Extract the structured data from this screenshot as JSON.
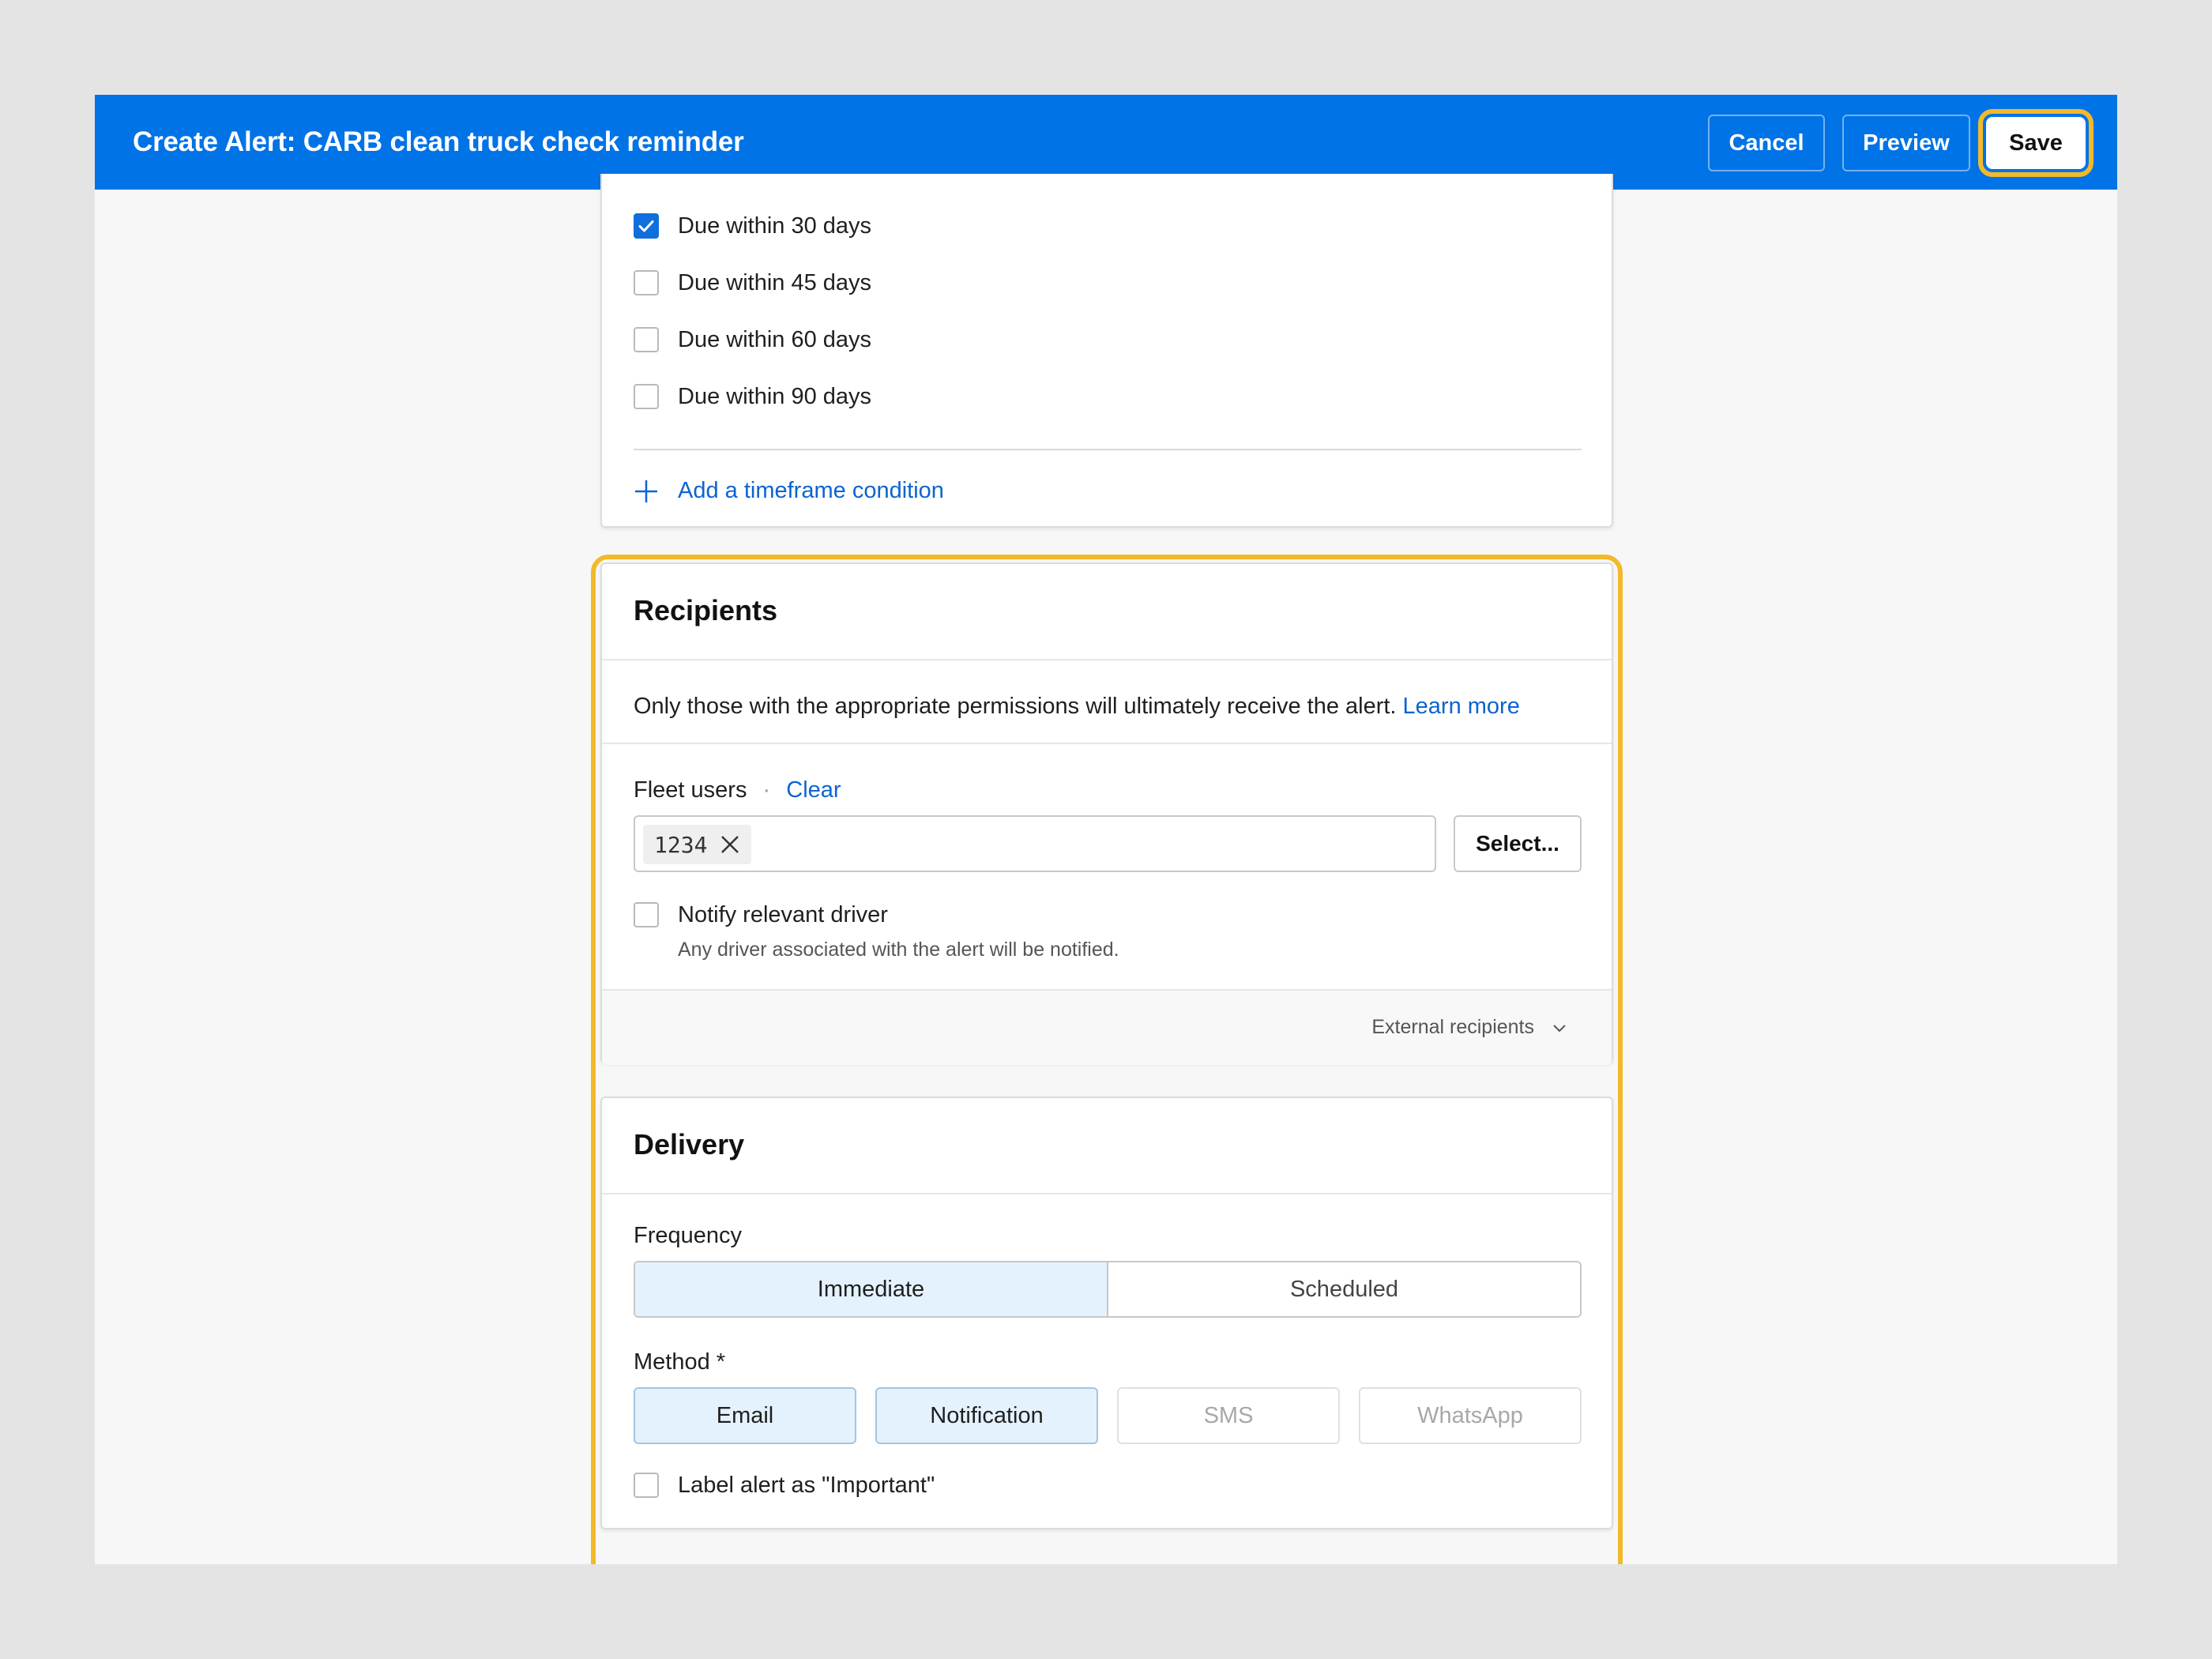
{
  "header": {
    "title": "Create Alert: CARB clean truck check reminder",
    "cancel_label": "Cancel",
    "preview_label": "Preview",
    "save_label": "Save"
  },
  "timeframe": {
    "options": [
      {
        "label": "Due within 30 days",
        "checked": true
      },
      {
        "label": "Due within 45 days",
        "checked": false
      },
      {
        "label": "Due within 60 days",
        "checked": false
      },
      {
        "label": "Due within 90 days",
        "checked": false
      }
    ],
    "add_condition_label": "Add a timeframe condition"
  },
  "recipients": {
    "title": "Recipients",
    "info_text": "Only those with the appropriate permissions will ultimately receive the alert.",
    "learn_more_label": "Learn more",
    "fleet_users_label": "Fleet users",
    "separator": "·",
    "clear_label": "Clear",
    "selected_users": [
      "1234"
    ],
    "select_button_label": "Select...",
    "notify_driver_label": "Notify relevant driver",
    "notify_driver_checked": false,
    "notify_driver_help": "Any driver associated with the alert will be notified.",
    "external_recipients_label": "External recipients"
  },
  "delivery": {
    "title": "Delivery",
    "frequency_label": "Frequency",
    "frequency_options": [
      "Immediate",
      "Scheduled"
    ],
    "frequency_selected": "Immediate",
    "method_label": "Method *",
    "methods": [
      {
        "label": "Email",
        "selected": true
      },
      {
        "label": "Notification",
        "selected": true
      },
      {
        "label": "SMS",
        "selected": false
      },
      {
        "label": "WhatsApp",
        "selected": false
      }
    ],
    "important_label": "Label alert as \"Important\"",
    "important_checked": false
  },
  "colors": {
    "header_bg": "#0073e6",
    "highlight": "#f2b92a",
    "link": "#0b63d1",
    "selected_bg": "#e4f2fd"
  }
}
